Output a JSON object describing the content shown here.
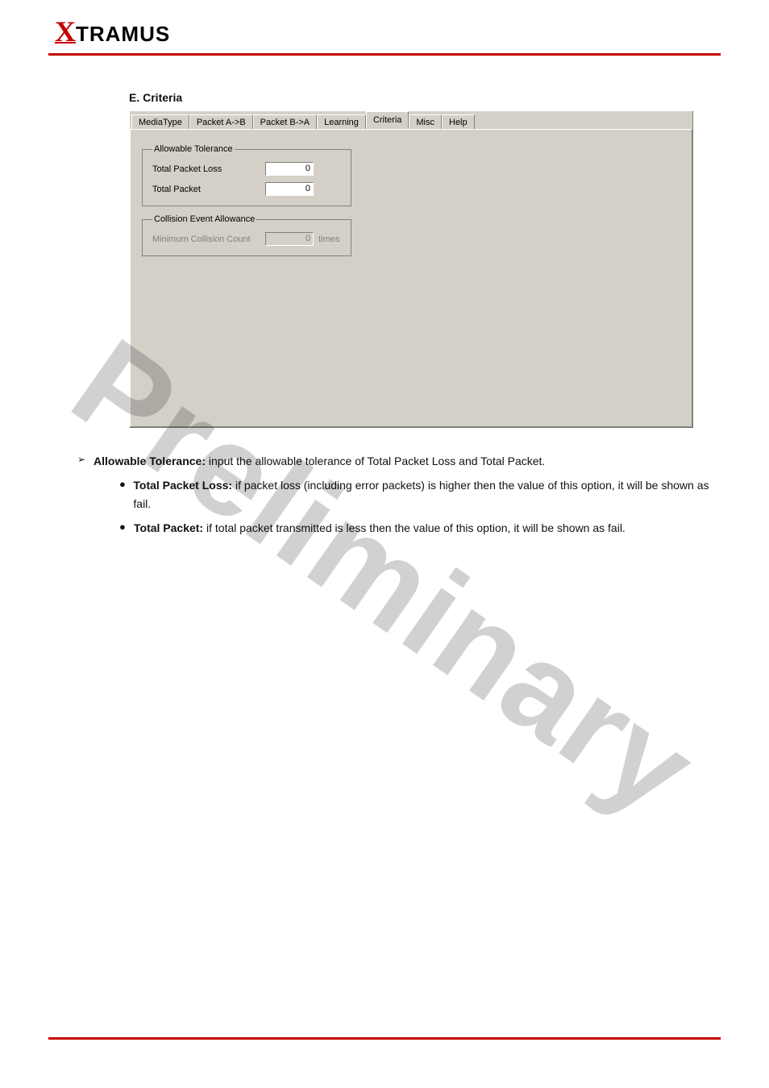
{
  "logo": {
    "x": "X",
    "rest": "TRAMUS"
  },
  "section_title": "E. Criteria",
  "tabs": [
    "MediaType",
    "Packet A->B",
    "Packet B->A",
    "Learning",
    "Criteria",
    "Misc",
    "Help"
  ],
  "active_tab_index": 4,
  "allowable_tolerance": {
    "legend": "Allowable Tolerance",
    "total_packet_loss_label": "Total Packet Loss",
    "total_packet_loss_value": "0",
    "total_packet_label": "Total Packet",
    "total_packet_value": "0"
  },
  "collision": {
    "legend": "Collision Event Allowance",
    "min_count_label": "Minimum Collision Count",
    "min_count_value": "0",
    "unit": "times"
  },
  "body_text": {
    "allowable_head": "Allowable Tolerance:",
    "allowable_tail": " input the allowable tolerance of Total Packet Loss and Total Packet.",
    "tpl_head": "Total Packet Loss:",
    "tpl_tail": " if packet loss (including error packets) is higher then the value of this option, it will be shown as fail.",
    "tp_head": "Total Packet:",
    "tp_tail": " if total packet transmitted is less then the value of this option, it will be shown as fail."
  },
  "watermark": "Preliminary"
}
